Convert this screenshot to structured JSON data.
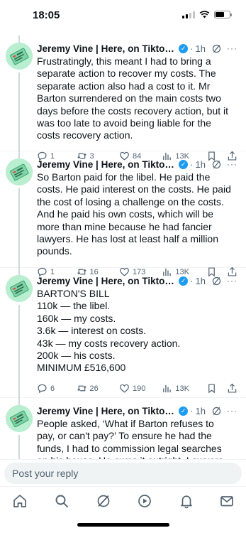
{
  "status_bar": {
    "time": "18:05"
  },
  "author": {
    "name": "Jeremy Vine | Here, on Tiktok, Ins...",
    "dot": "·",
    "age": "1h"
  },
  "tweets": [
    {
      "text": "Frustratingly, this meant I had to bring a separate action to recover my costs. The separate action also had a cost to it. Mr Barton surrendered on the main costs two days before the costs recovery action, but it was too late to avoid being liable for the costs recovery action.",
      "replies": "1",
      "reposts": "3",
      "likes": "84",
      "views": "13K"
    },
    {
      "text": "So Barton paid for the libel. He paid the costs. He paid interest on the costs. He paid the cost of losing a challenge on the costs. And he paid his own costs, which will be more than mine because he had fancier lawyers. He has lost at least half a million pounds.",
      "replies": "1",
      "reposts": "16",
      "likes": "173",
      "views": "13K"
    },
    {
      "text": "BARTON'S BILL\n110k — the libel.\n160k — my costs.\n3.6k — interest on costs.\n43k — my costs recovery action.\n200k — his costs.\nMINIMUM £516,600",
      "replies": "6",
      "reposts": "26",
      "likes": "190",
      "views": "13K"
    },
    {
      "text": "People asked, ‘What if Barton refuses to pay, or can't pay?’ To ensure he had the funds, I had to commission legal searches on his house. He owns it outright. Lawyers advised me that if he did not pay, they could put a charge on his",
      "replies": "",
      "reposts": "",
      "likes": "",
      "views": ""
    }
  ],
  "reply_box": {
    "placeholder": "Post your reply"
  },
  "icons": {
    "accent": "#1d9bf0",
    "tabs": [
      "home-icon",
      "search-icon",
      "grok-icon",
      "video-icon",
      "notifications-icon",
      "messages-icon"
    ]
  }
}
